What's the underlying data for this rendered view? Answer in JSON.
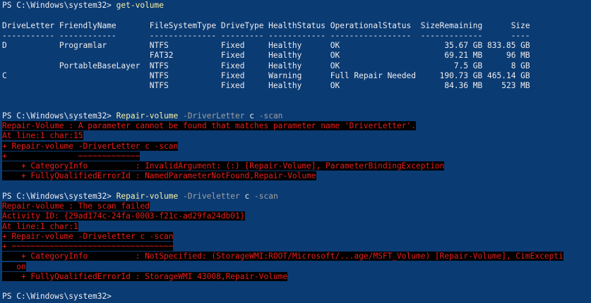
{
  "prompt": "PS C:\\Windows\\system32> ",
  "cmd1": "get-volume",
  "table": {
    "header": "DriveLetter FriendlyName       FileSystemType DriveType HealthStatus OperationalStatus  SizeRemaining      Size",
    "divider": "----------- ------------       -------------- --------- ------------ -----------------  -------------      ----",
    "rows": [
      "D           Programlar         NTFS           Fixed     Healthy      OK                      35.67 GB 833.85 GB",
      "                               FAT32          Fixed     Healthy      OK                      69.21 MB     96 MB",
      "            PortableBaseLayer  NTFS           Fixed     Healthy      OK                        7.5 GB      8 GB",
      "C                              NTFS           Fixed     Warning      Full Repair Needed     190.73 GB 465.14 GB",
      "                               NTFS           Fixed     Healthy      OK                      84.36 MB    523 MB"
    ]
  },
  "cmd2": {
    "name": "Repair-volume",
    "param": " -DriverLetter",
    "arg": " c",
    "flag": " -scan"
  },
  "err1": [
    "Repair-Volume : A parameter cannot be found that matches parameter name 'DriverLetter'.",
    "At line:1 char:15",
    "+ Repair-volume -DriverLetter c -scan",
    "+               ~~~~~~~~~~~~~",
    "    + CategoryInfo          : InvalidArgument: (:) [Repair-Volume], ParameterBindingException",
    "    + FullyQualifiedErrorId : NamedParameterNotFound,Repair-Volume"
  ],
  "cmd3": {
    "name": "Repair-volume",
    "param": " -Driveletter",
    "arg": " c",
    "flag": " -scan"
  },
  "err2": [
    "Repair-volume : The scan failed",
    "Activity ID: {29ad174c-24fa-0003-f21c-ad29fa24db01}",
    "At line:1 char:1",
    "+ Repair-volume -Driveletter c -scan",
    "+ ~~~~~~~~~~~~~~~~~~~~~~~~~~~~~~~~~~",
    "    + CategoryInfo          : NotSpecified: (StorageWMI:ROOT/Microsoft/...age/MSFT_Volume) [Repair-Volume], CimExcepti",
    "   on",
    "    + FullyQualifiedErrorId : StorageWMI 43008,Repair-Volume"
  ],
  "final_prompt": "PS C:\\Windows\\system32> "
}
